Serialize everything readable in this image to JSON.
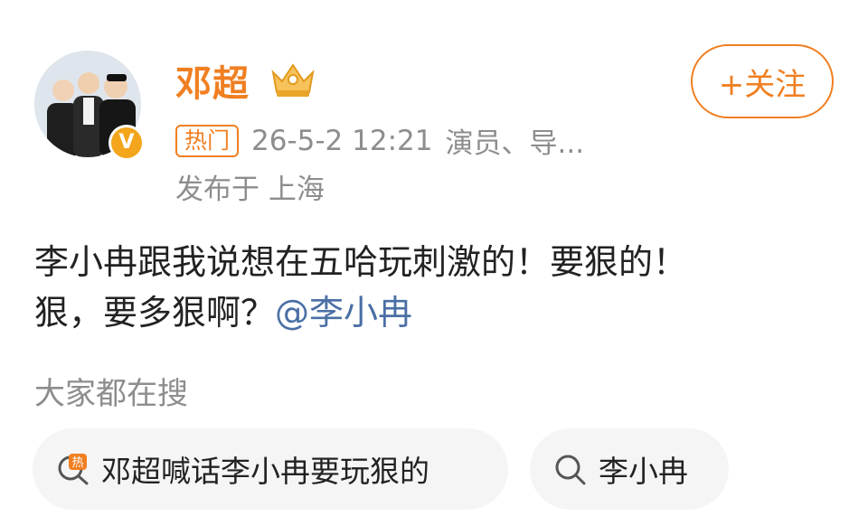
{
  "post": {
    "author": "邓超",
    "badge": "热门",
    "timestamp": "26-5-2 12:21",
    "tagline": "演员、导...",
    "location": "发布于 上海",
    "follow_label": "+关注",
    "text_line1": "李小冉跟我说想在五哈玩刺激的！要狠的！",
    "text_line2_prefix": "狠，要多狠啊？",
    "mention": "@李小冉"
  },
  "search": {
    "section_title": "大家都在搜",
    "items": [
      {
        "label": "邓超喊话李小冉要玩狠的",
        "icon": "hot-search-icon"
      },
      {
        "label": "李小冉",
        "icon": "search-icon"
      }
    ]
  },
  "colors": {
    "accent": "#f07f21",
    "mention": "#4a6fa5",
    "muted": "#8d8d8d",
    "text": "#222222",
    "verified": "#f3a51b"
  }
}
